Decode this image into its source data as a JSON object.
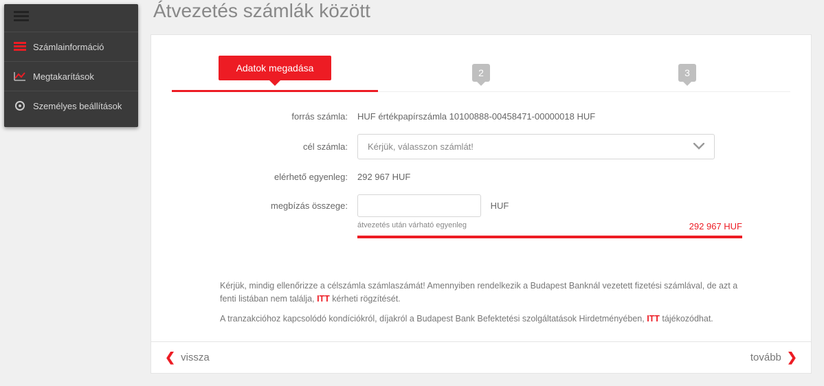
{
  "page_title": "Átvezetés számlák között",
  "sidebar": {
    "items": [
      {
        "label": "Számlainformáció"
      },
      {
        "label": "Megtakarítások"
      },
      {
        "label": "Személyes beállítások"
      }
    ]
  },
  "steps": {
    "active_label": "Adatok megadása",
    "step2": "2",
    "step3": "3"
  },
  "form": {
    "source_label": "forrás számla:",
    "source_value": "HUF értékpapírszámla 10100888-00458471-00000018 HUF",
    "target_label": "cél számla:",
    "target_placeholder": "Kérjük, válasszon számlát!",
    "balance_label": "elérhető egyenleg:",
    "balance_value": "292 967 HUF",
    "amount_label": "megbízás összege:",
    "amount_value": "",
    "amount_currency": "HUF",
    "after_label": "átvezetés után várható egyenleg",
    "after_value": "292 967 HUF"
  },
  "notes": {
    "p1a": "Kérjük, mindig ellenőrizze a célszámla számlaszámát! Amennyiben rendelkezik a Budapest Banknál vezetett fizetési számlával, de azt a fenti listában nem találja, ",
    "p1_link": "ITT",
    "p1b": " kérheti rögzítését.",
    "p2a": "A tranzakcióhoz kapcsolódó kondíciókról, díjakról a Budapest Bank Befektetési szolgáltatások Hirdetményében, ",
    "p2_link": "ITT",
    "p2b": " tájékozódhat."
  },
  "footer": {
    "back": "vissza",
    "next": "tovább"
  }
}
